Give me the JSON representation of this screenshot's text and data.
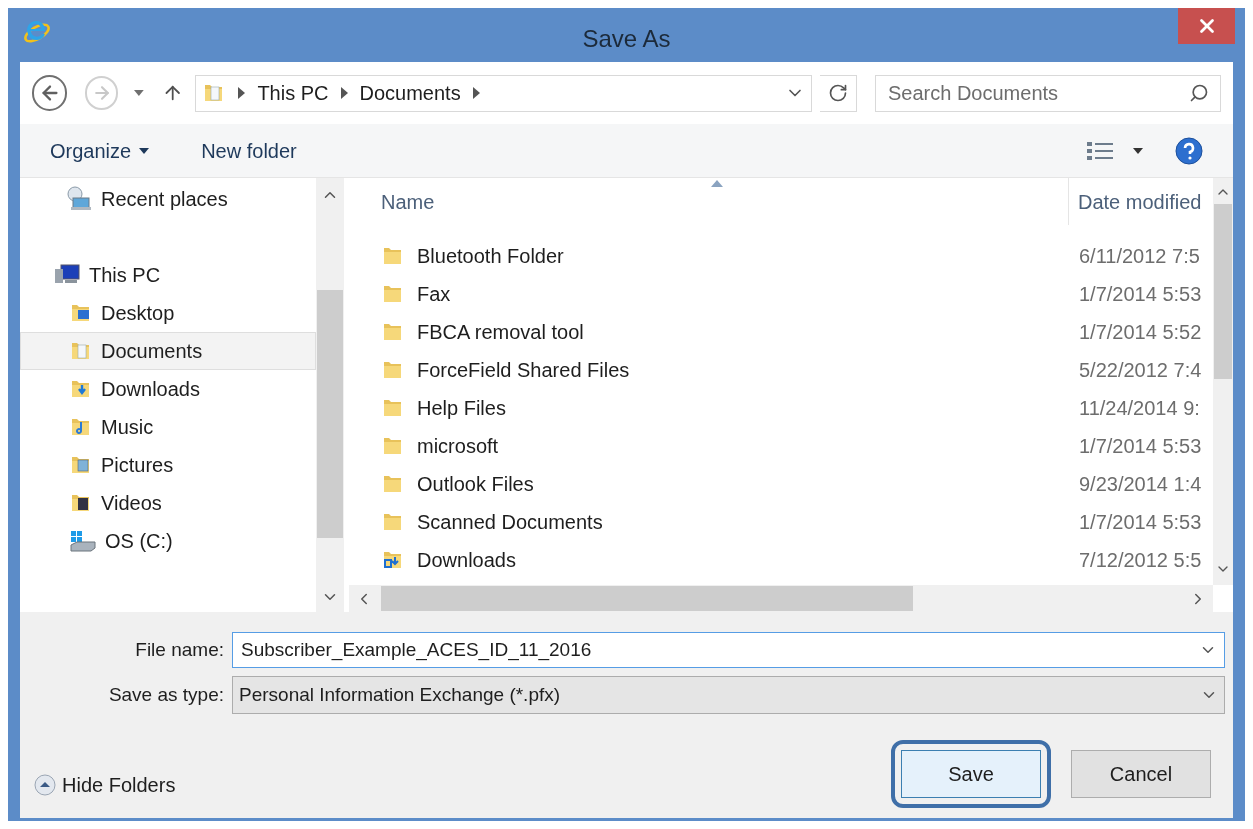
{
  "window": {
    "title": "Save As"
  },
  "address_bar": {
    "breadcrumbs": [
      "This PC",
      "Documents"
    ]
  },
  "search": {
    "placeholder": "Search Documents"
  },
  "toolbar": {
    "organize": "Organize",
    "new_folder": "New folder"
  },
  "sidebar": {
    "items": [
      {
        "label": "Recent places",
        "kind": "recent",
        "selected": false
      },
      {
        "label": "This PC",
        "kind": "computer",
        "selected": false,
        "children": [
          {
            "label": "Desktop",
            "kind": "desktop",
            "selected": false
          },
          {
            "label": "Documents",
            "kind": "documents",
            "selected": true
          },
          {
            "label": "Downloads",
            "kind": "downloads",
            "selected": false
          },
          {
            "label": "Music",
            "kind": "music",
            "selected": false
          },
          {
            "label": "Pictures",
            "kind": "pictures",
            "selected": false
          },
          {
            "label": "Videos",
            "kind": "videos",
            "selected": false
          },
          {
            "label": "OS (C:)",
            "kind": "drive",
            "selected": false
          }
        ]
      }
    ]
  },
  "file_list": {
    "columns": [
      "Name",
      "Date modified"
    ],
    "rows": [
      {
        "name": "Bluetooth Folder",
        "date": "6/11/2012 7:5",
        "kind": "folder"
      },
      {
        "name": "Fax",
        "date": "1/7/2014 5:53",
        "kind": "folder"
      },
      {
        "name": "FBCA removal tool",
        "date": "1/7/2014 5:52",
        "kind": "folder"
      },
      {
        "name": "ForceField Shared Files",
        "date": "5/22/2012 7:4",
        "kind": "folder"
      },
      {
        "name": "Help Files",
        "date": "11/24/2014 9:",
        "kind": "folder"
      },
      {
        "name": "microsoft",
        "date": "1/7/2014 5:53",
        "kind": "folder"
      },
      {
        "name": "Outlook Files",
        "date": "9/23/2014 1:4",
        "kind": "folder"
      },
      {
        "name": "Scanned Documents",
        "date": "1/7/2014 5:53",
        "kind": "folder"
      },
      {
        "name": "Downloads",
        "date": "7/12/2012 5:5",
        "kind": "shortcut"
      }
    ]
  },
  "form": {
    "file_name": {
      "label": "File name:",
      "value": "Subscriber_Example_ACES_ID_11_2016"
    },
    "save_as_type": {
      "label": "Save as type:",
      "value": "Personal Information Exchange (*.pfx)"
    }
  },
  "hide_folders": "Hide Folders",
  "buttons": [
    {
      "label": "Save",
      "highlighted": true
    },
    {
      "label": "Cancel",
      "highlighted": false
    }
  ]
}
